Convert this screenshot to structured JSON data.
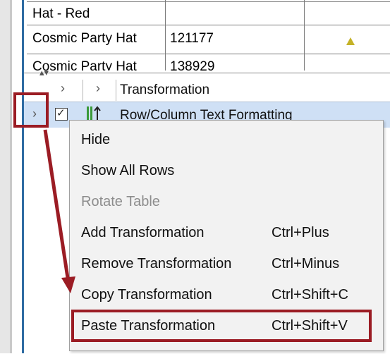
{
  "table": {
    "rows": [
      {
        "name": "Hat - Red",
        "id": ""
      },
      {
        "name": "Cosmic Party Hat",
        "id": "121177"
      },
      {
        "name": "Cosmic Party Hat",
        "id": "138929"
      }
    ]
  },
  "transformation_panel": {
    "header_label": "Transformation",
    "row_label": "Row/Column Text Formatting",
    "row_checked": true
  },
  "context_menu": {
    "items": [
      {
        "label": "Hide",
        "shortcut": "",
        "enabled": true
      },
      {
        "label": "Show All Rows",
        "shortcut": "",
        "enabled": true
      },
      {
        "label": "Rotate Table",
        "shortcut": "",
        "enabled": false
      },
      {
        "label": "Add Transformation",
        "shortcut": "Ctrl+Plus",
        "enabled": true
      },
      {
        "label": "Remove Transformation",
        "shortcut": "Ctrl+Minus",
        "enabled": true
      },
      {
        "label": "Copy Transformation",
        "shortcut": "Ctrl+Shift+C",
        "enabled": true
      },
      {
        "label": "Paste Transformation",
        "shortcut": "Ctrl+Shift+V",
        "enabled": true
      }
    ]
  },
  "colors": {
    "highlight": "#9b1c24",
    "selected_row": "#cfe0f5",
    "menu_bg": "#f2f2f2"
  }
}
